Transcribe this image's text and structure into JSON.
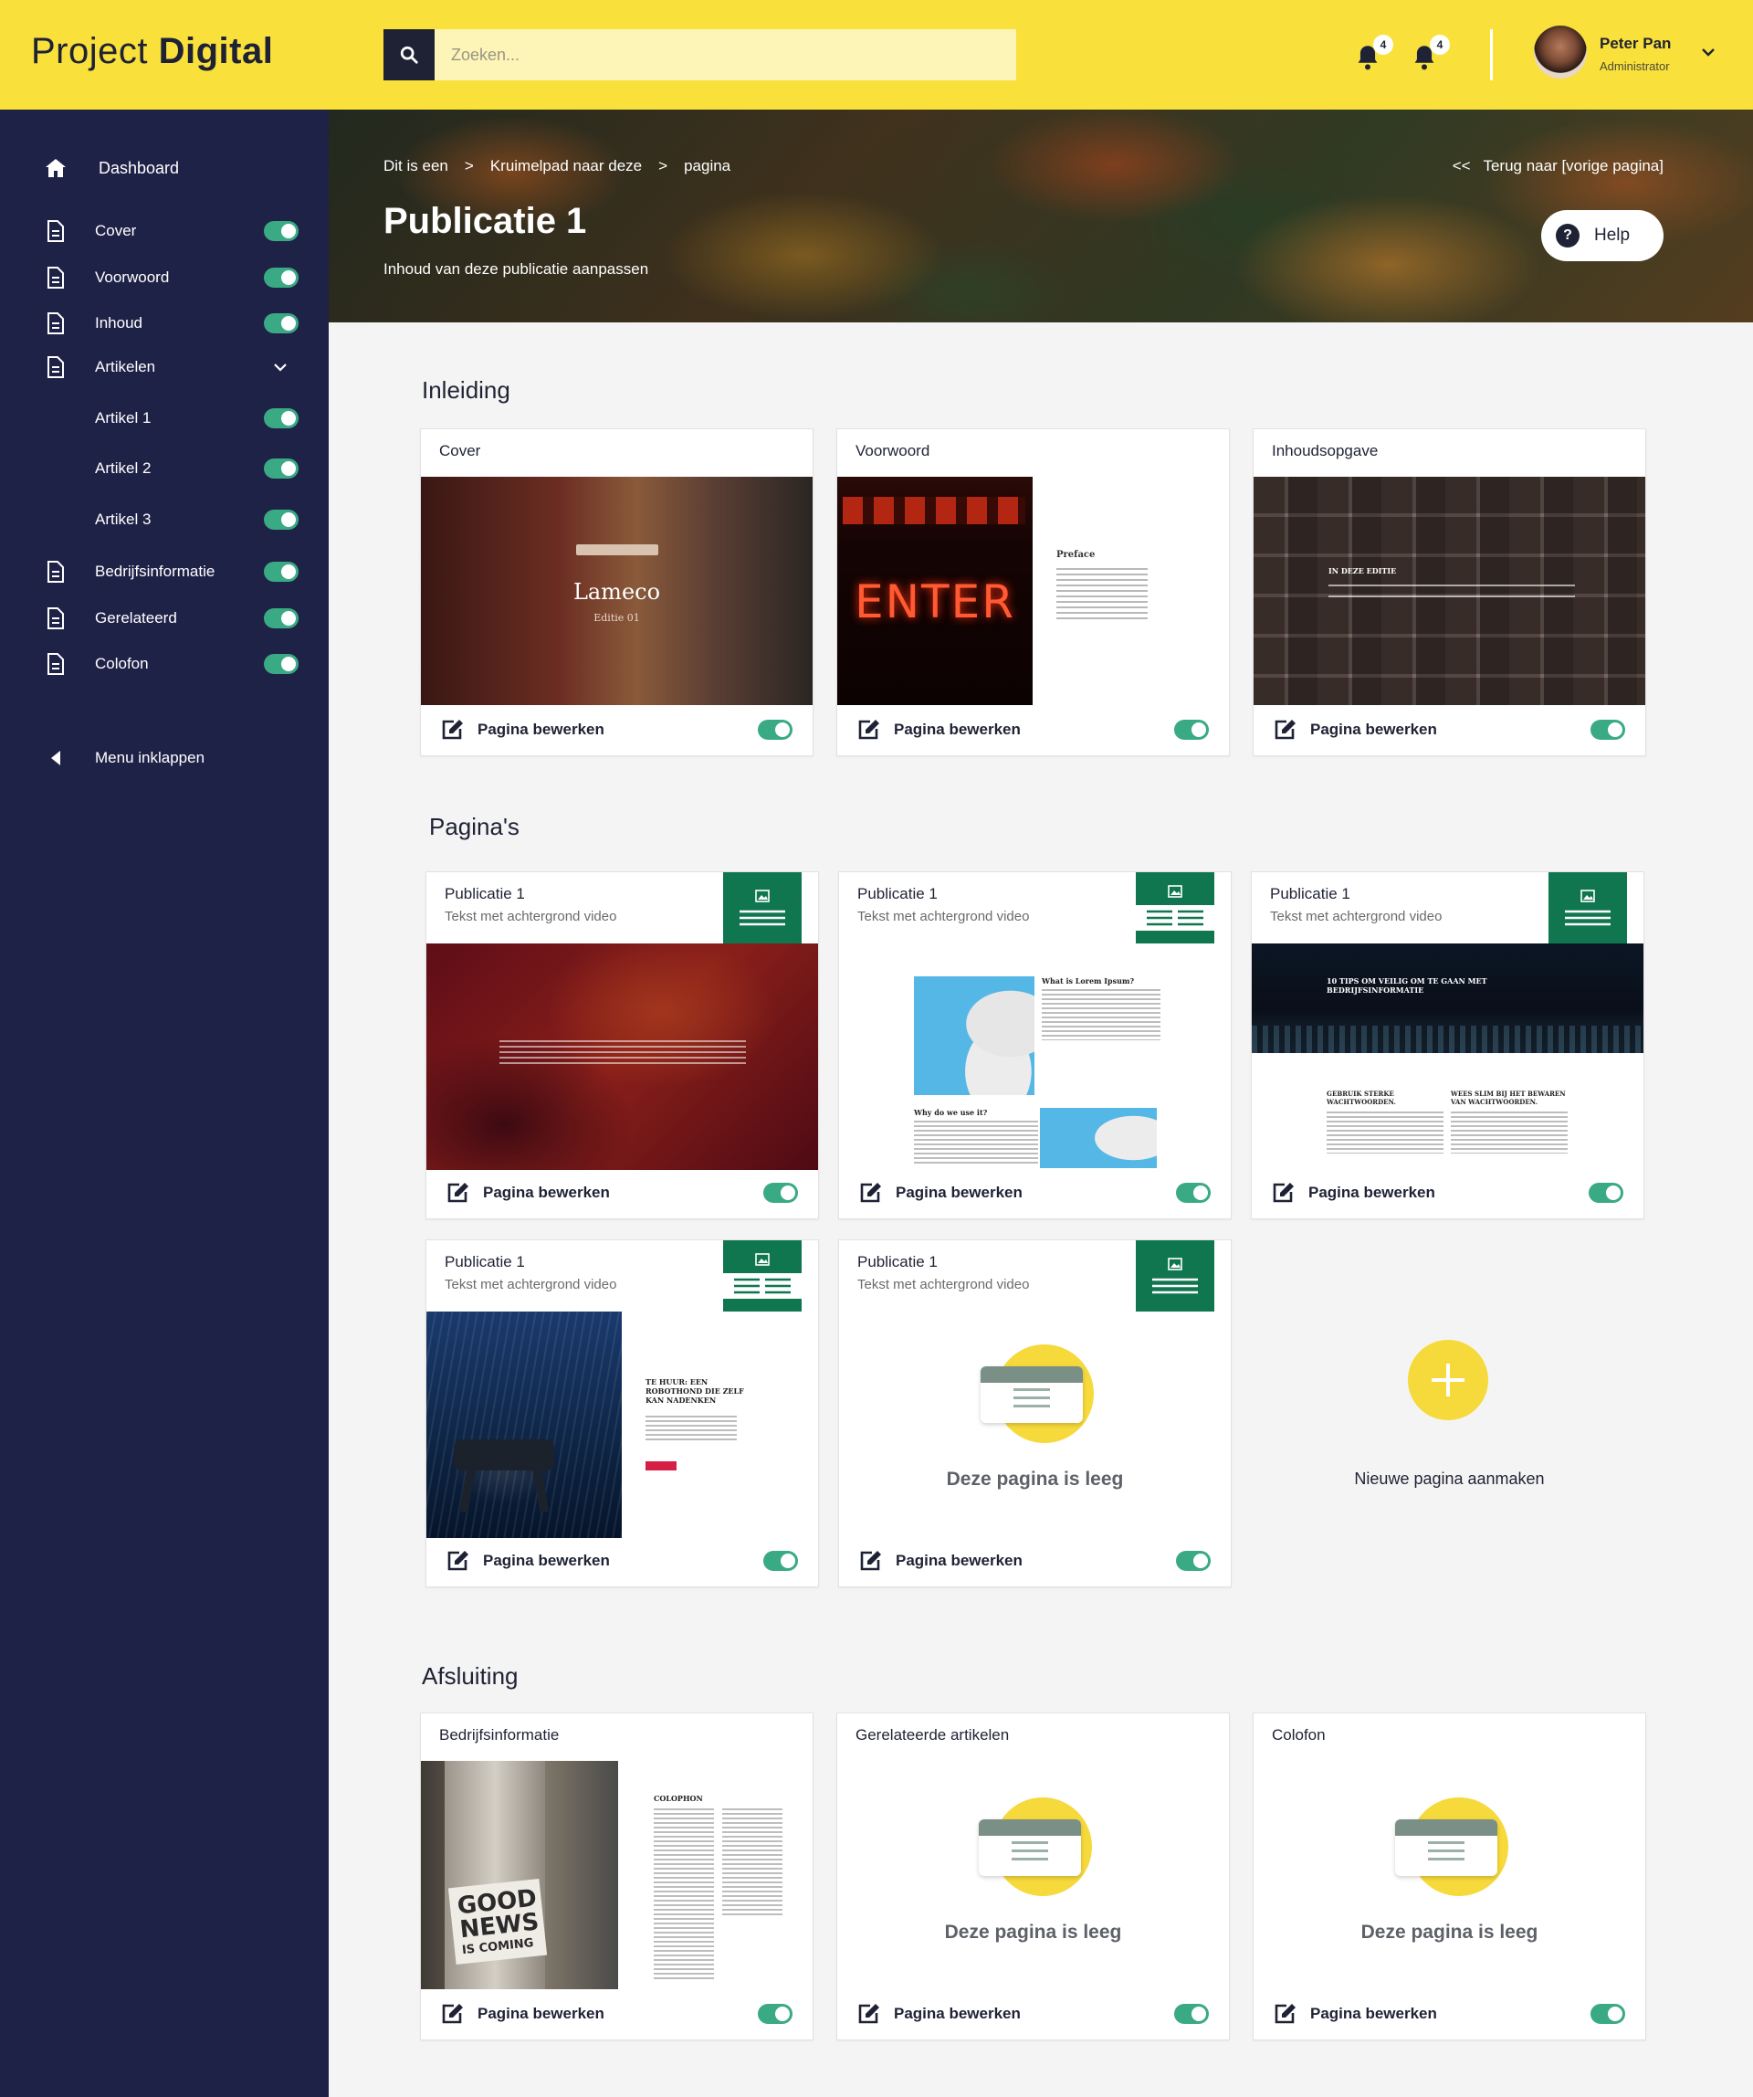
{
  "header": {
    "logo_light": "Project",
    "logo_bold": "Digital",
    "search_placeholder": "Zoeken...",
    "notifications": [
      {
        "icon": "bell-icon",
        "count": "4"
      },
      {
        "icon": "bell-icon",
        "count": "4"
      }
    ],
    "user": {
      "name": "Peter Pan",
      "role": "Administrator"
    }
  },
  "sidebar": {
    "dashboard": "Dashboard",
    "items": [
      {
        "label": "Cover",
        "enabled": true
      },
      {
        "label": "Voorwoord",
        "enabled": true
      },
      {
        "label": "Inhoud",
        "enabled": true
      },
      {
        "label": "Artikelen",
        "expanded": true
      },
      {
        "label": "Artikel 1",
        "enabled": true
      },
      {
        "label": "Artikel 2",
        "enabled": true
      },
      {
        "label": "Artikel 3",
        "enabled": true
      },
      {
        "label": "Bedrijfsinformatie",
        "enabled": true
      },
      {
        "label": "Gerelateerd",
        "enabled": true
      },
      {
        "label": "Colofon",
        "enabled": true
      }
    ],
    "collapse": "Menu inklappen"
  },
  "hero": {
    "breadcrumb": [
      "Dit is een",
      ">",
      "Kruimelpad naar deze",
      ">",
      "pagina"
    ],
    "back": "<<   Terug naar [vorige pagina]",
    "title": "Publicatie 1",
    "subtitle": "Inhoud van deze publicatie aanpassen",
    "help": "Help"
  },
  "edit_label": "Pagina bewerken",
  "empty_label": "Deze pagina is leeg",
  "sections": {
    "intro": {
      "title": "Inleiding",
      "cards": [
        {
          "label": "Cover",
          "thumb_title": "Lameco",
          "thumb_sub": "Editie 01",
          "enabled": true
        },
        {
          "label": "Voorwoord",
          "thumb_neon": "ENTER",
          "thumb_heading": "Preface",
          "enabled": true
        },
        {
          "label": "Inhoudsopgave",
          "thumb_heading": "IN DEZE EDITIE",
          "enabled": true
        }
      ]
    },
    "pages": {
      "title": "Pagina's",
      "cards": [
        {
          "label": "Publicatie 1",
          "sub": "Tekst met achtergrond video",
          "enabled": true
        },
        {
          "label": "Publicatie 1",
          "sub": "Tekst met achtergrond video",
          "thumb_heading": "What is Lorem Ipsum?",
          "thumb_heading2": "Why do we use it?",
          "enabled": true
        },
        {
          "label": "Publicatie 1",
          "sub": "Tekst met achtergrond video",
          "thumb_heading": "10 TIPS OM VEILIG OM TE GAAN MET BEDRIJFSINFORMATIE",
          "thumb_col1": "GEBRUIK STERKE WACHTWOORDEN.",
          "thumb_col2": "WEES SLIM BIJ HET BEWAREN VAN WACHTWOORDEN.",
          "enabled": true
        },
        {
          "label": "Publicatie 1",
          "sub": "Tekst met achtergrond video",
          "thumb_heading": "TE HUUR: EEN ROBOTHOND DIE ZELF KAN NADENKEN",
          "enabled": true
        },
        {
          "label": "Publicatie 1",
          "sub": "Tekst met achtergrond video",
          "empty": true,
          "enabled": true
        }
      ],
      "new_page": "Nieuwe pagina aanmaken"
    },
    "closing": {
      "title": "Afsluiting",
      "cards": [
        {
          "label": "Bedrijfsinformatie",
          "thumb_heading": "COLOPHON",
          "thumb_sign1": "GOOD",
          "thumb_sign2": "NEWS",
          "thumb_sign3": "IS COMING",
          "enabled": true
        },
        {
          "label": "Gerelateerde artikelen",
          "empty": true,
          "enabled": true
        },
        {
          "label": "Colofon",
          "empty": true,
          "enabled": true
        }
      ]
    }
  },
  "colors": {
    "accent": "#f9e03b",
    "sidebar": "#1f2247",
    "toggle_on": "#3aaa85",
    "template_badge": "#0f7650"
  }
}
